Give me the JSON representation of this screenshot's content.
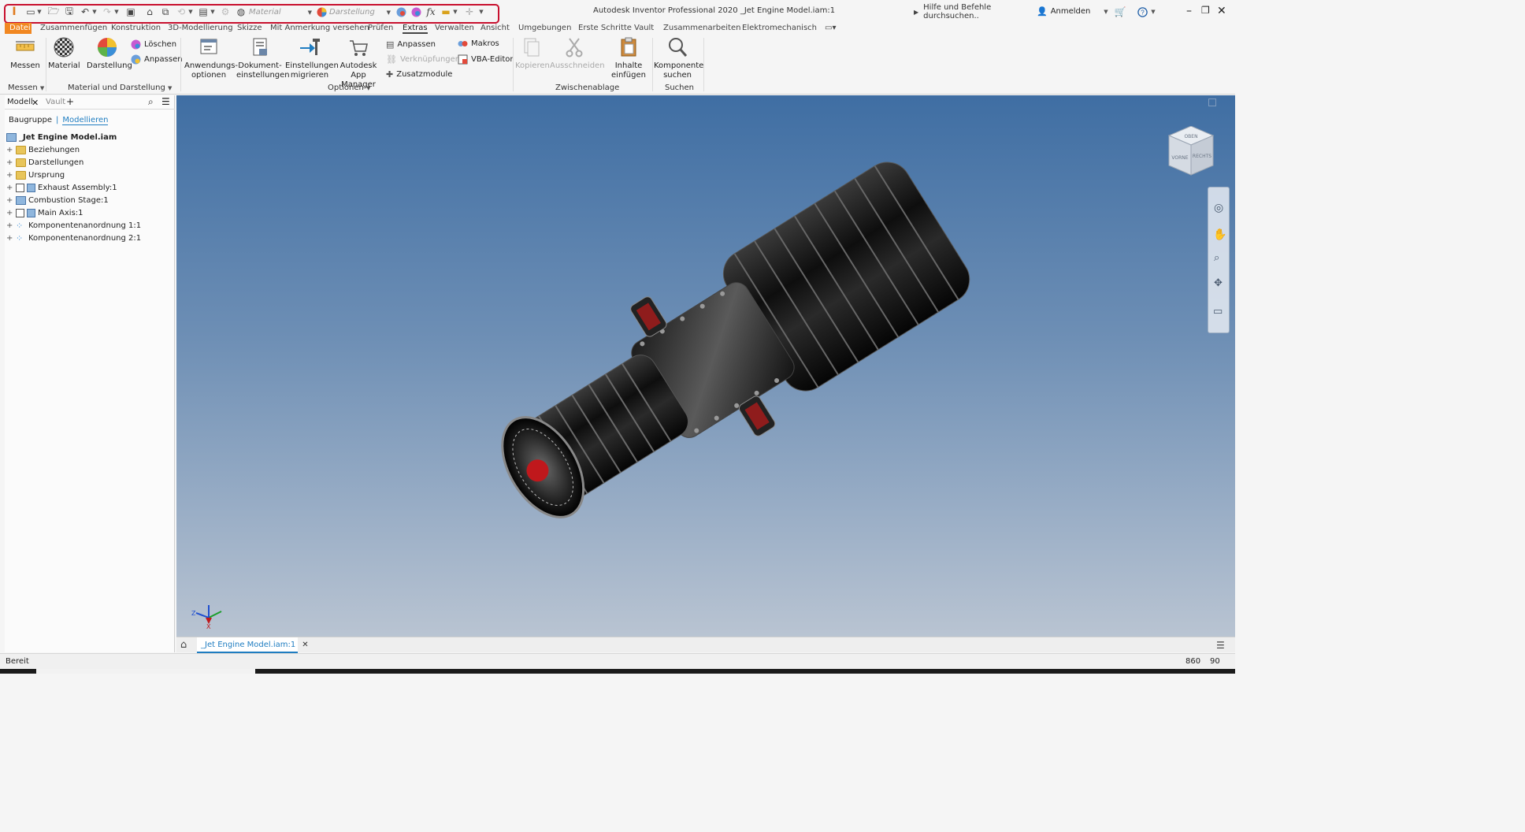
{
  "window": {
    "title": "Autodesk Inventor Professional 2020   _Jet Engine Model.iam:1",
    "search_placeholder": "Hilfe und Befehle durchsuchen..",
    "signin": "Anmelden"
  },
  "qat": {
    "material_placeholder": "Material",
    "appearance_placeholder": "Darstellung",
    "highlight_color": "#c8102e"
  },
  "tabs": [
    {
      "label": "Datei"
    },
    {
      "label": "Zusammenfügen"
    },
    {
      "label": "Konstruktion"
    },
    {
      "label": "3D-Modellierung"
    },
    {
      "label": "Skizze"
    },
    {
      "label": "Mit Anmerkung versehen"
    },
    {
      "label": "Prüfen"
    },
    {
      "label": "Extras"
    },
    {
      "label": "Verwalten"
    },
    {
      "label": "Ansicht"
    },
    {
      "label": "Umgebungen"
    },
    {
      "label": "Erste Schritte"
    },
    {
      "label": "Vault"
    },
    {
      "label": "Zusammenarbeiten"
    },
    {
      "label": "Elektromechanisch"
    }
  ],
  "ribbon": {
    "measure": {
      "label": "Messen",
      "group": "Messen"
    },
    "material": {
      "label": "Material"
    },
    "appearance": {
      "label": "Darstellung"
    },
    "delete": {
      "label": "Löschen"
    },
    "adjust": {
      "label": "Anpassen"
    },
    "material_group": "Material und Darstellung",
    "app_options": {
      "line1": "Anwendungs-",
      "line2": "optionen"
    },
    "doc_settings": {
      "line1": "Dokument-",
      "line2": "einstellungen"
    },
    "migrate": {
      "line1": "Einstellungen",
      "line2": "migrieren"
    },
    "app_manager": {
      "line1": "Autodesk",
      "line2": "App Manager"
    },
    "customize": {
      "label": "Anpassen"
    },
    "links": {
      "label": "Verknüpfungen"
    },
    "addins": {
      "label": "Zusatzmodule"
    },
    "macros": {
      "label": "Makros"
    },
    "vba": {
      "label": "VBA-Editor"
    },
    "options_group": "Optionen",
    "copy": {
      "label": "Kopieren"
    },
    "cut": {
      "label": "Ausschneiden"
    },
    "paste": {
      "line1": "Inhalte",
      "line2": "einfügen"
    },
    "clipboard_group": "Zwischenablage",
    "find": {
      "line1": "Komponente",
      "line2": "suchen"
    },
    "search_group": "Suchen"
  },
  "browser": {
    "tab_model": "Modell",
    "tab_vault": "Vault",
    "view_assembly": "Baugruppe",
    "view_modeling": "Modellieren",
    "root": "_Jet Engine Model.iam",
    "items": [
      {
        "label": "Beziehungen",
        "icon": "folder-icon"
      },
      {
        "label": "Darstellungen",
        "icon": "representations-icon"
      },
      {
        "label": "Ursprung",
        "icon": "folder-icon"
      },
      {
        "label": "Exhaust Assembly:1",
        "icon": "subassembly-icon"
      },
      {
        "label": "Combustion Stage:1",
        "icon": "subassembly-icon"
      },
      {
        "label": "Main Axis:1",
        "icon": "subassembly-icon"
      },
      {
        "label": "Komponentenanordnung 1:1",
        "icon": "pattern-icon"
      },
      {
        "label": "Komponentenanordnung 2:1",
        "icon": "pattern-icon"
      }
    ]
  },
  "viewcube": {
    "top": "OBEN",
    "front": "VORNE",
    "right": "RECHTS"
  },
  "document_tab": {
    "label": "_Jet Engine Model.iam:1"
  },
  "status": {
    "text": "Bereit",
    "count_a": "860",
    "count_b": "90"
  },
  "colors": {
    "file_tab": "#f18721",
    "active_link": "#1f7dc1",
    "viewport_top": "#3f6ea3",
    "viewport_bottom": "#b9c4d2"
  }
}
